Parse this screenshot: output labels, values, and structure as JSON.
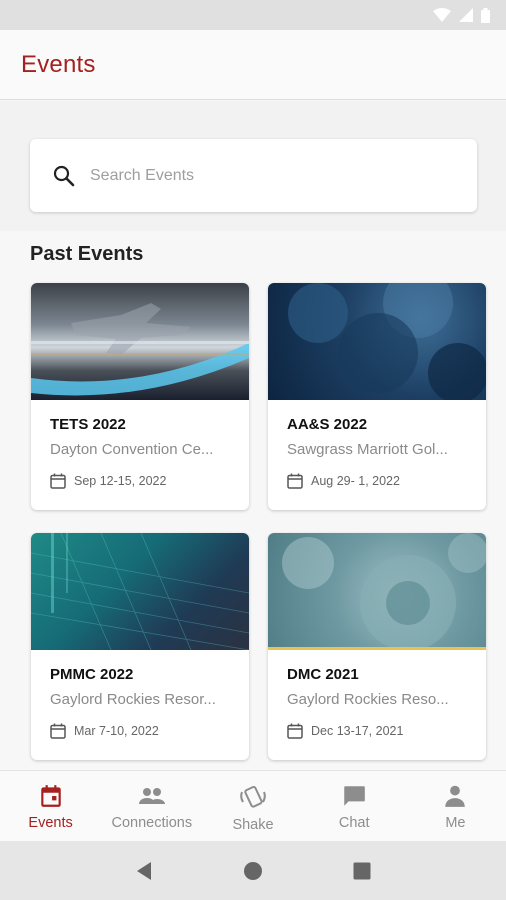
{
  "app": {
    "title": "Events"
  },
  "search": {
    "placeholder": "Search Events"
  },
  "section": {
    "past_events_title": "Past Events"
  },
  "events": [
    {
      "title": "TETS 2022",
      "venue": "Dayton Convention Ce...",
      "date": "Sep 12-15, 2022"
    },
    {
      "title": "AA&S 2022",
      "venue": "Sawgrass Marriott Gol...",
      "date": "Aug 29- 1, 2022"
    },
    {
      "title": "PMMC 2022",
      "venue": "Gaylord Rockies Resor...",
      "date": "Mar  7-10, 2022"
    },
    {
      "title": "DMC 2021",
      "venue": "Gaylord  Rockies Reso...",
      "date": "Dec 13-17, 2021"
    }
  ],
  "bottom_nav": [
    {
      "label": "Events",
      "icon": "calendar-icon",
      "active": true
    },
    {
      "label": "Connections",
      "icon": "people-icon",
      "active": false
    },
    {
      "label": "Shake",
      "icon": "shake-phone-icon",
      "active": false
    },
    {
      "label": "Chat",
      "icon": "chat-icon",
      "active": false
    },
    {
      "label": "Me",
      "icon": "person-icon",
      "active": false
    }
  ],
  "colors": {
    "brand": "#a5201f",
    "nav_inactive": "#8d8d8d",
    "background": "#f7f7f7"
  }
}
